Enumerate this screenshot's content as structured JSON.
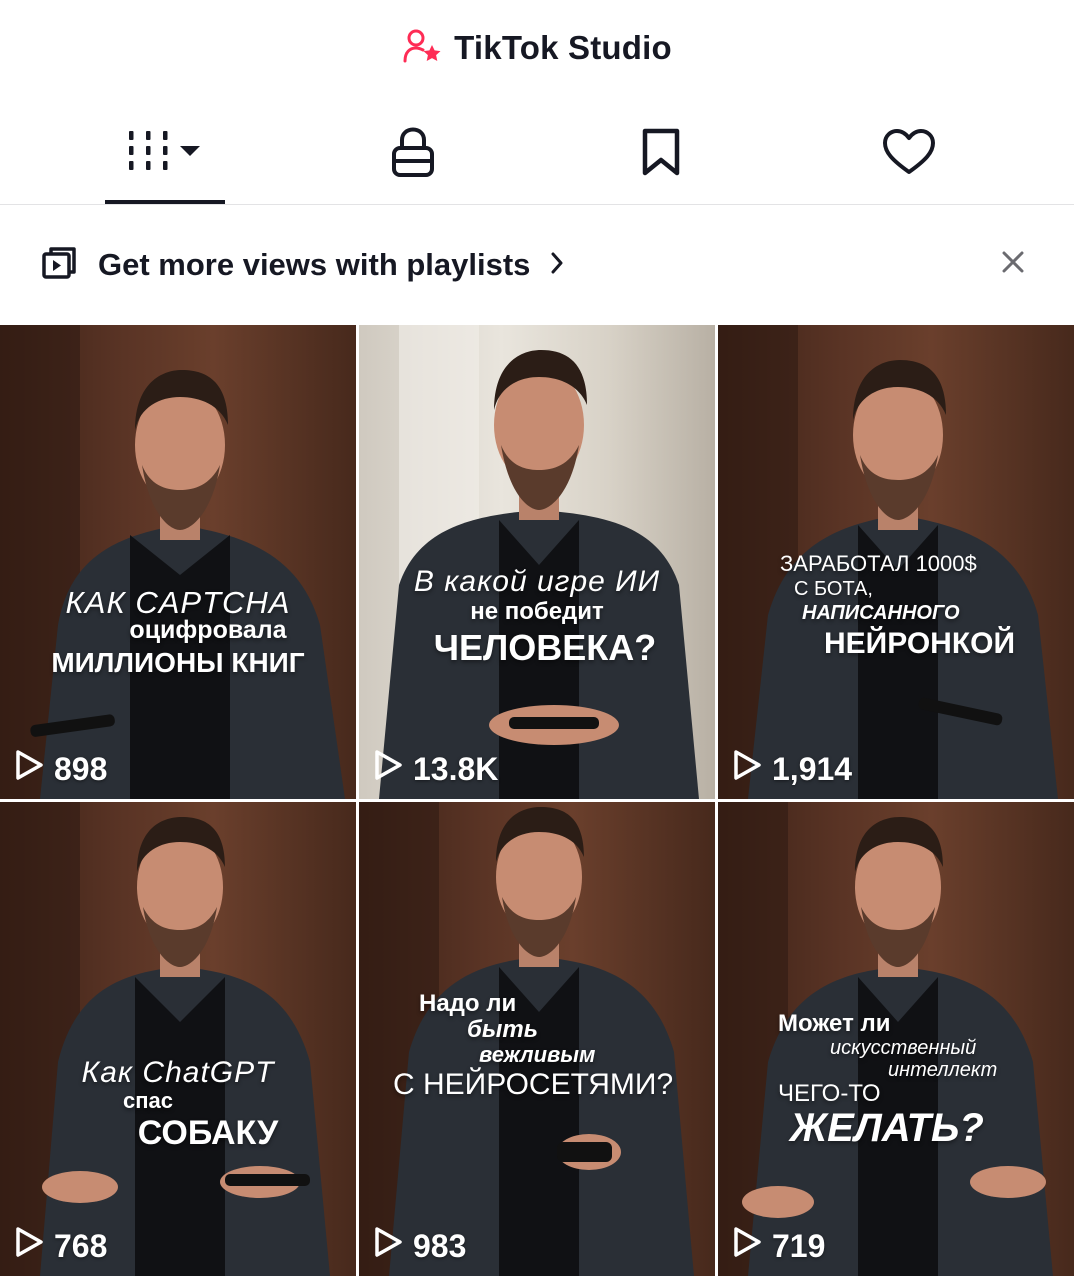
{
  "header": {
    "title": "TikTok Studio",
    "icon": "creator-star-icon",
    "accent": "#fe2c55"
  },
  "tabs": [
    {
      "name": "videos",
      "icon": "grid-bars-icon",
      "active": true
    },
    {
      "name": "private",
      "icon": "lock-icon",
      "active": false
    },
    {
      "name": "favorites",
      "icon": "bookmark-icon",
      "active": false
    },
    {
      "name": "liked",
      "icon": "heart-icon",
      "active": false
    }
  ],
  "banner": {
    "text": "Get more views with playlists",
    "icon": "playlist-icon",
    "close_icon": "close-icon"
  },
  "videos": [
    {
      "lines": [
        "КАК CAPTCHA",
        "оцифровала",
        "МИЛЛИОНЫ КНИГ"
      ],
      "views": "898"
    },
    {
      "lines": [
        "В какой игре ИИ",
        "не победит",
        "ЧЕЛОВЕКА?"
      ],
      "views": "13.8K"
    },
    {
      "lines": [
        "ЗАРАБОТАЛ 1000$",
        "С БОТА,",
        "НАПИСАННОГО",
        "НЕЙРОНКОЙ"
      ],
      "views": "1,914"
    },
    {
      "lines": [
        "Как ChatGPT",
        "спас",
        "СОБАКУ"
      ],
      "views": "768"
    },
    {
      "lines": [
        "Надо ли",
        "быть",
        "вежливым",
        "С НЕЙРОСЕТЯМИ?"
      ],
      "views": "983"
    },
    {
      "lines": [
        "Может ли",
        "искусственный",
        "интеллект",
        "ЧЕГО-ТО",
        "ЖЕЛАТЬ?"
      ],
      "views": "719"
    }
  ]
}
